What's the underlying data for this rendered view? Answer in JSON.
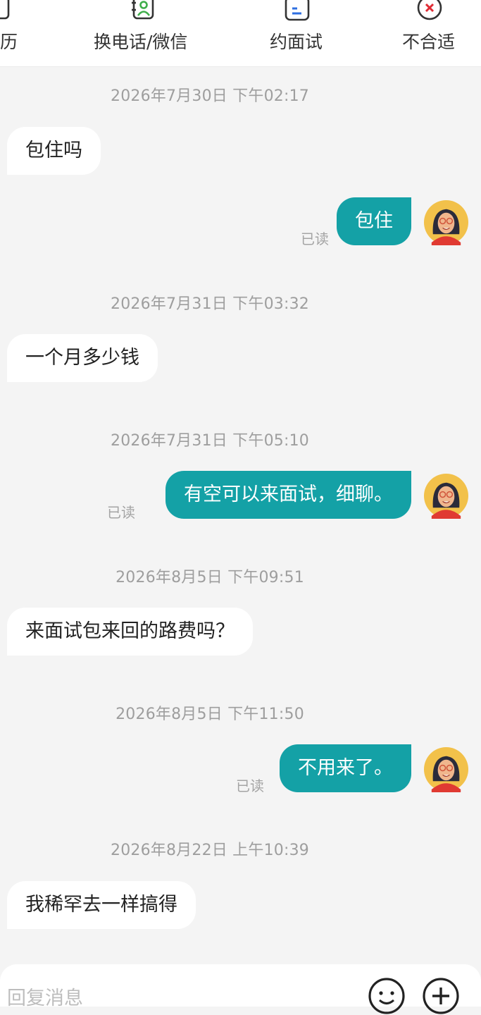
{
  "actions": {
    "resume": "历",
    "swap_contact": "换电话/微信",
    "interview": "约面试",
    "not_suitable": "不合适"
  },
  "messages": [
    {
      "time": "2026年7月30日 下午02:17"
    },
    {
      "text": "包住吗"
    },
    {
      "text": "包住",
      "status": "已读"
    },
    {
      "time": "2026年7月31日 下午03:32"
    },
    {
      "text": "一个月多少钱"
    },
    {
      "time": "2026年7月31日 下午05:10"
    },
    {
      "text": "有空可以来面试，细聊。",
      "status": "已读"
    },
    {
      "time": "2026年8月5日 下午09:51"
    },
    {
      "text": "来面试包来回的路费吗？"
    },
    {
      "time": "2026年8月5日 下午11:50"
    },
    {
      "text": "不用来了。",
      "status": "已读"
    },
    {
      "time": "2026年8月22日 上午10:39"
    },
    {
      "text": "我稀罕去一样搞得"
    }
  ],
  "input": {
    "placeholder": "回复消息"
  },
  "colors": {
    "accent": "#14a1a6",
    "contact_icon": "#3fae4a",
    "interview_icon": "#2f6fe0",
    "reject_icon": "#e02b34"
  }
}
